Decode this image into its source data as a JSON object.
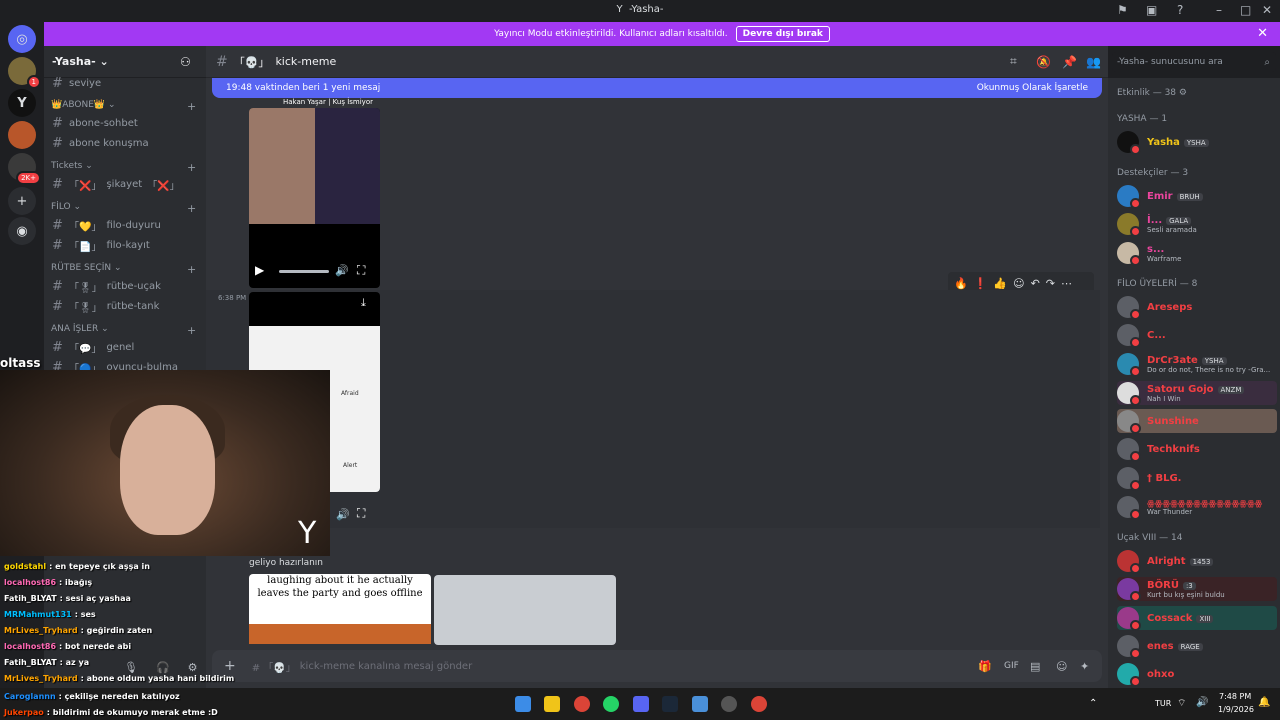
{
  "window": {
    "title": "-Yasha-",
    "app_logo": "Y",
    "icons": [
      "inbox-icon",
      "screen-icon",
      "help-icon",
      "minimize-icon",
      "maximize-icon",
      "close-icon"
    ]
  },
  "banner": {
    "text": "Yayıncı Modu etkinleştirildi. Kullanıcı adları kısaltıldı.",
    "button": "Devre dışı bırak",
    "close": "✕"
  },
  "rail": {
    "badges": {
      "one": "1",
      "big": "2K+"
    }
  },
  "server": {
    "name": "-Yasha-",
    "categories": [
      {
        "label": "ABONE",
        "channels": [
          "abone-sohbet",
          "abone konuşma"
        ]
      },
      {
        "label": "Tickets",
        "channels": [
          "şikayet"
        ]
      },
      {
        "label": "FİLO",
        "channels": [
          "filo-duyuru",
          "filo-kayıt"
        ]
      },
      {
        "label": "RÜTBE SEÇİN",
        "channels": [
          "rütbe-uçak",
          "rütbe-tank"
        ]
      },
      {
        "label": "ANA İŞLER",
        "channels": [
          "genel",
          "oyuncu-bulma"
        ]
      }
    ],
    "seviye": "seviye"
  },
  "channel": {
    "name": "kick-meme",
    "new_messages": "19:48 vaktinden beri 1 yeni mesaj",
    "mark_read": "Okunmuş Olarak İşaretle",
    "timestamp_1": "6:38 PM",
    "image_labels": [
      "Afraid",
      "Alert"
    ],
    "message_text": "geliyo hazırlanın",
    "meme_text": "laughing about it he actually leaves the party and goes offline",
    "composer_placeholder": "kick-meme kanalına mesaj gönder",
    "video_caption": "Hakan Yaşar | Kuş İsmiyor"
  },
  "members": {
    "search_placeholder": "-Yasha- sunucusunu ara",
    "activity": "Etkinlik — 38",
    "groups": [
      {
        "label": "YASHA — 1",
        "members": [
          {
            "name": "Yasha",
            "tag": "YSHA",
            "color": "#f0c419"
          }
        ]
      },
      {
        "label": "Destekçiler — 3",
        "members": [
          {
            "name": "Emir",
            "tag": "BRUH",
            "color": "#eb459e"
          },
          {
            "name": "İ...",
            "tag": "GALA",
            "sub": "Sesli aramada",
            "color": "#eb459e"
          },
          {
            "name": "s...",
            "sub": "Warframe",
            "color": "#eb459e"
          }
        ]
      },
      {
        "label": "FİLO ÜYELERİ — 8",
        "members": [
          {
            "name": "Areseps",
            "color": "#f23f43"
          },
          {
            "name": "C...",
            "color": "#f23f43"
          },
          {
            "name": "DrCr3ate",
            "tag": "YSHA",
            "sub": "Do or do not, There is no try -Gra...",
            "color": "#f23f43"
          },
          {
            "name": "Satoru Gojo",
            "tag": "ANZM",
            "sub": "Nah I Win",
            "color": "#f23f43"
          },
          {
            "name": "Sunshine",
            "color": "#f23f43"
          },
          {
            "name": "Techknifs",
            "color": "#f23f43"
          },
          {
            "name": "† BLG.",
            "color": "#f23f43"
          },
          {
            "name": "ꙮꙮꙮꙮꙮꙮꙮꙮꙮꙮꙮꙮꙮꙮꙮ",
            "sub": "War Thunder",
            "color": "#f23f43"
          }
        ]
      },
      {
        "label": "Uçak VIII — 14",
        "members": [
          {
            "name": "Alright",
            "tag": "1453",
            "color": "#f23f43"
          },
          {
            "name": "BÖRÜ",
            "tag": ":3",
            "sub": "Kurt bu kış eşini buldu",
            "color": "#f23f43"
          },
          {
            "name": "Cossack",
            "tag": "XIII",
            "color": "#f23f43"
          },
          {
            "name": "enes",
            "tag": "RAGE",
            "color": "#f23f43"
          },
          {
            "name": "ohxo",
            "color": "#f23f43"
          }
        ]
      }
    ]
  },
  "stream_chat": [
    {
      "user": "goldstahl",
      "msg": ": en tepeye çık aşşa in",
      "color": "#ffd700"
    },
    {
      "user": "localhost86",
      "msg": ": ibağış",
      "color": "#ff69b4"
    },
    {
      "user": "Fatih_BLYAT",
      "msg": ": sesi aç yashaa",
      "color": "#ffffff"
    },
    {
      "user": "MRMahmut131",
      "msg": ": ses",
      "color": "#00bfff"
    },
    {
      "user": "MrLives_Tryhard",
      "msg": ": geğirdin zaten",
      "color": "#ffa500"
    },
    {
      "user": "localhost86",
      "msg": ": bot nerede abi",
      "color": "#ff69b4"
    },
    {
      "user": "Fatih_BLYAT",
      "msg": ": az ya",
      "color": "#ffffff"
    },
    {
      "user": "MrLives_Tryhard",
      "msg": ": abone oldum yasha hani bildirim",
      "color": "#ffa500"
    },
    {
      "user": "Caroglannn",
      "msg": ": çekilişe nereden katılıyoz",
      "color": "#1e90ff"
    },
    {
      "user": "Jukerpao",
      "msg": ": bildirimi de okumuyo merak etme :D",
      "color": "#ff4500"
    }
  ],
  "overlay_text": "oltass",
  "taskbar": {
    "lang": "TUR",
    "time": "7:48 PM",
    "date": "1/9/2026"
  },
  "colors": {
    "accent": "#5865f2",
    "banner": "#a239f3"
  }
}
